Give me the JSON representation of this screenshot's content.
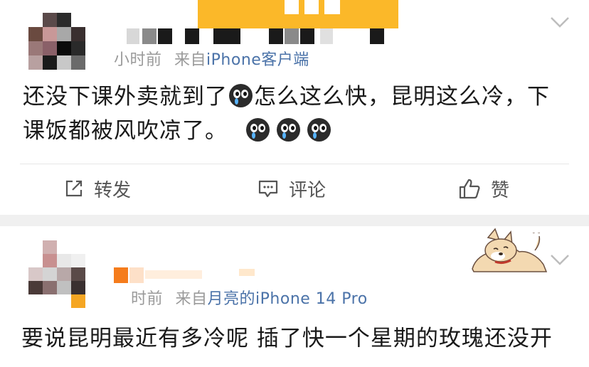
{
  "post1": {
    "meta_time": "小时前",
    "meta_from": "来自",
    "meta_source": "iPhone客户端",
    "content_line1_a": "还没下课外卖就到了",
    "content_line1_b": "怎么这么快，昆明这么冷，下",
    "content_line2": "课饭都被风吹凉了。",
    "emoji_name": "crying-face-emoji"
  },
  "actions": {
    "repost": "转发",
    "comment": "评论",
    "like": "赞"
  },
  "post2": {
    "meta_time": "时前",
    "meta_from": "来自",
    "meta_source": "月亮的iPhone 14 Pro",
    "content_line1": "要说昆明最近有多冷呢 插了快一个星期的玫瑰还没开"
  },
  "colors": {
    "accent_yellow": "#fbb829",
    "source_link": "#4a72a8",
    "meta_gray": "#9a9a9a",
    "orange": "#f57c1c"
  },
  "icons": [
    "repost-icon",
    "comment-icon",
    "like-icon",
    "chevron-down-icon",
    "dog-sticker"
  ]
}
